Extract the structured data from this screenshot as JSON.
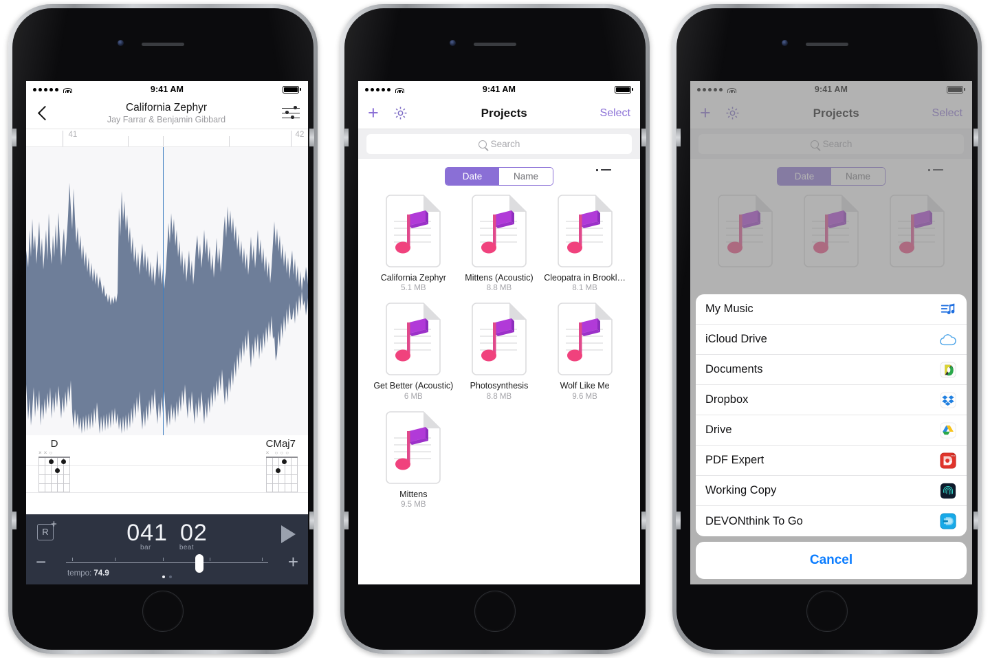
{
  "status_bar": {
    "time": "9:41 AM",
    "signal_dots": 5,
    "wifi": "wifi-icon",
    "battery": "battery-full-icon"
  },
  "phone1": {
    "nav": {
      "back": "back-chevron-icon",
      "title": "California Zephyr",
      "subtitle": "Jay Farrar & Benjamin Gibbard",
      "settings": "sliders-icon"
    },
    "ruler": {
      "labels": [
        "41",
        "42"
      ]
    },
    "waveform": {
      "playhead_percent": 48.5,
      "color": "#6e7e99",
      "background": "#f7f7f9",
      "playhead_color": "#3f7fc1"
    },
    "chords": [
      {
        "name": "D",
        "open_marks": "××○"
      },
      {
        "name": "CMaj7",
        "open_marks": "× ○○○"
      }
    ],
    "transport": {
      "record_label": "R",
      "record_add": "+",
      "bar_value": "041",
      "beat_value": "02",
      "bar_label": "bar",
      "beat_label": "beat",
      "play": "play-icon",
      "minus": "−",
      "plus": "+",
      "tempo_label": "tempo:",
      "tempo_value": "74.9",
      "slider_percent": 66,
      "page_dots": 2,
      "page_active": 1
    }
  },
  "phone2": {
    "nav": {
      "add": "+",
      "settings": "gear-icon",
      "title": "Projects",
      "select": "Select"
    },
    "search": {
      "placeholder": "Search",
      "icon": "search-icon"
    },
    "segmented": {
      "options": [
        "Date",
        "Name"
      ],
      "selected": "Date",
      "accent": "#8a6fd6"
    },
    "list_view_icon": "list-view-icon",
    "files": [
      {
        "name": "California Zephyr",
        "size": "5.1 MB"
      },
      {
        "name": "Mittens (Acoustic)",
        "size": "8.8 MB"
      },
      {
        "name": "Cleopatra in Brookl…",
        "size": "8.1 MB"
      },
      {
        "name": "Get Better (Acoustic)",
        "size": "6 MB"
      },
      {
        "name": "Photosynthesis",
        "size": "8.8 MB"
      },
      {
        "name": "Wolf Like Me",
        "size": "9.6 MB"
      },
      {
        "name": "Mittens",
        "size": "9.5 MB"
      }
    ]
  },
  "phone3": {
    "nav": {
      "add": "+",
      "settings": "gear-icon",
      "title": "Projects",
      "select": "Select"
    },
    "search": {
      "placeholder": "Search",
      "icon": "search-icon"
    },
    "segmented": {
      "options": [
        "Date",
        "Name"
      ],
      "selected": "Date",
      "accent": "#8a6fd6"
    },
    "list_view_icon": "list-view-icon",
    "action_sheet": {
      "items": [
        {
          "label": "My Music",
          "icon": "my-music-icon"
        },
        {
          "label": "iCloud Drive",
          "icon": "icloud-drive-icon"
        },
        {
          "label": "Documents",
          "icon": "documents-app-icon"
        },
        {
          "label": "Dropbox",
          "icon": "dropbox-icon"
        },
        {
          "label": "Drive",
          "icon": "google-drive-icon"
        },
        {
          "label": "PDF Expert",
          "icon": "pdf-expert-icon"
        },
        {
          "label": "Working Copy",
          "icon": "working-copy-icon"
        },
        {
          "label": "DEVONthink To Go",
          "icon": "devonthink-icon"
        }
      ],
      "cancel": "Cancel",
      "cancel_color": "#0a7cff"
    }
  }
}
